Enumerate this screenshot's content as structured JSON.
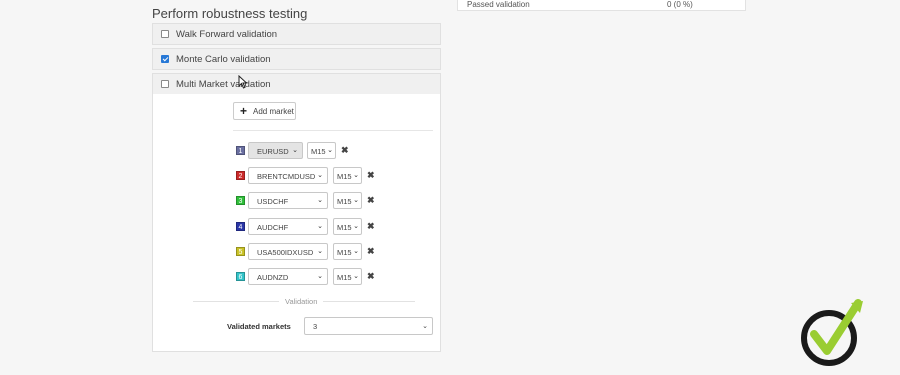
{
  "section_title": "Perform robustness testing",
  "summary": {
    "passed_label": "Passed validation",
    "passed_value": "0 (0 %)"
  },
  "options": [
    {
      "label": "Walk Forward validation",
      "checked": false
    },
    {
      "label": "Monte Carlo validation",
      "checked": true
    },
    {
      "label": "Multi Market validation",
      "checked": false
    }
  ],
  "multi_market": {
    "add_button_label": "Add market",
    "markets": [
      {
        "index": "1",
        "color": "#6a6fa0",
        "symbol": "EURUSD",
        "timeframe": "M15",
        "disabled": true
      },
      {
        "index": "2",
        "color": "#cc2a2a",
        "symbol": "BRENTCMDUSD",
        "timeframe": "M15",
        "disabled": false
      },
      {
        "index": "3",
        "color": "#2fbf3a",
        "symbol": "USDCHF",
        "timeframe": "M15",
        "disabled": false
      },
      {
        "index": "4",
        "color": "#2a36a8",
        "symbol": "AUDCHF",
        "timeframe": "M15",
        "disabled": false
      },
      {
        "index": "5",
        "color": "#c9c227",
        "symbol": "USA500IDXUSD",
        "timeframe": "M15",
        "disabled": false
      },
      {
        "index": "6",
        "color": "#33c4c9",
        "symbol": "AUDNZD",
        "timeframe": "M15",
        "disabled": false
      }
    ],
    "validation_header": "Validation",
    "validated_markets_label": "Validated markets",
    "validated_markets_value": "3"
  },
  "icons": {
    "add": "plus-icon",
    "remove": "close-icon",
    "dropdown": "chevron-down-icon",
    "logo": "checkmark-logo-icon",
    "cursor": "mouse-cursor-icon"
  },
  "colors": {
    "checkbox_checked": "#2778d6",
    "logo_green": "#9acd32",
    "logo_dark": "#1a1a1a"
  }
}
